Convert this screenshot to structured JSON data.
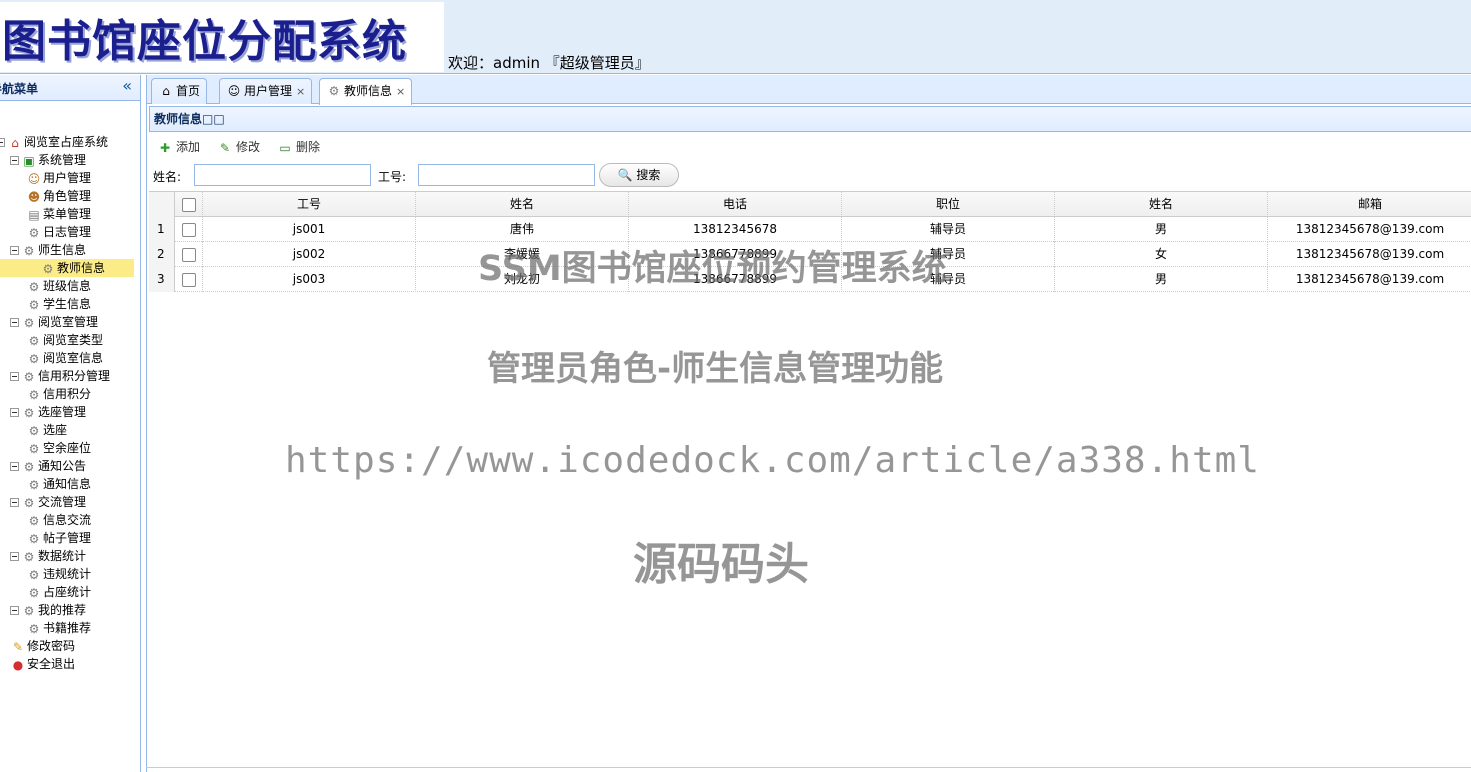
{
  "header": {
    "logo_text": "图书馆座位分配系统",
    "welcome": "欢迎：admin 『超级管理员』"
  },
  "sidebar": {
    "title": "导航菜单",
    "collapse_icon": "double-chevron-left-icon",
    "tree": [
      {
        "label": "阅览室占座系统",
        "icon": "home-icon"
      },
      {
        "label": "系统管理",
        "icon": "folder-icon"
      },
      {
        "label": "用户管理",
        "icon": "user-icon"
      },
      {
        "label": "角色管理",
        "icon": "users-icon"
      },
      {
        "label": "菜单管理",
        "icon": "menu-icon"
      },
      {
        "label": "日志管理",
        "icon": "gear-icon"
      },
      {
        "label": "师生信息",
        "icon": "gear-icon"
      },
      {
        "label": "教师信息",
        "icon": "gear-icon"
      },
      {
        "label": "班级信息",
        "icon": "gear-icon"
      },
      {
        "label": "学生信息",
        "icon": "gear-icon"
      },
      {
        "label": "阅览室管理",
        "icon": "gear-icon"
      },
      {
        "label": "阅览室类型",
        "icon": "gear-icon"
      },
      {
        "label": "阅览室信息",
        "icon": "gear-icon"
      },
      {
        "label": "信用积分管理",
        "icon": "gear-icon"
      },
      {
        "label": "信用积分",
        "icon": "gear-icon"
      },
      {
        "label": "选座管理",
        "icon": "gear-icon"
      },
      {
        "label": "选座",
        "icon": "gear-icon"
      },
      {
        "label": "空余座位",
        "icon": "gear-icon"
      },
      {
        "label": "通知公告",
        "icon": "gear-icon"
      },
      {
        "label": "通知信息",
        "icon": "gear-icon"
      },
      {
        "label": "交流管理",
        "icon": "gear-icon"
      },
      {
        "label": "信息交流",
        "icon": "gear-icon"
      },
      {
        "label": "帖子管理",
        "icon": "gear-icon"
      },
      {
        "label": "数据统计",
        "icon": "gear-icon"
      },
      {
        "label": "违规统计",
        "icon": "gear-icon"
      },
      {
        "label": "占座统计",
        "icon": "gear-icon"
      },
      {
        "label": "我的推荐",
        "icon": "gear-icon"
      },
      {
        "label": "书籍推荐",
        "icon": "gear-icon"
      },
      {
        "label": "修改密码",
        "icon": "lock-icon"
      },
      {
        "label": "安全退出",
        "icon": "exit-icon"
      }
    ],
    "selected": "教师信息"
  },
  "tabs": [
    {
      "label": "首页",
      "icon": "home-icon",
      "closable": false
    },
    {
      "label": "用户管理",
      "icon": "user-icon",
      "closable": true
    },
    {
      "label": "教师信息",
      "icon": "gear-icon",
      "closable": true,
      "active": true
    }
  ],
  "panel": {
    "title": "教师信息□□"
  },
  "toolbar": {
    "add_label": "添加",
    "edit_label": "修改",
    "delete_label": "删除"
  },
  "search": {
    "name_label": "姓名:",
    "name_value": "",
    "id_label": "工号:",
    "id_value": "",
    "button_label": "搜索"
  },
  "table": {
    "columns": [
      "工号",
      "姓名",
      "电话",
      "职位",
      "姓名",
      "邮箱"
    ],
    "rows": [
      {
        "num": "1",
        "cells": [
          "js001",
          "唐伟",
          "13812345678",
          "辅导员",
          "男",
          "13812345678@139.com"
        ]
      },
      {
        "num": "2",
        "cells": [
          "js002",
          "李媛媛",
          "13866778899",
          "辅导员",
          "女",
          "13812345678@139.com"
        ]
      },
      {
        "num": "3",
        "cells": [
          "js003",
          "刘龙初",
          "13866778899",
          "辅导员",
          "男",
          "13812345678@139.com"
        ]
      }
    ]
  },
  "watermark": {
    "line1": "SSM图书馆座位预约管理系统",
    "line2": "管理员角色-师生信息管理功能",
    "line3": "https://www.icodedock.com/article/a338.html",
    "line4": "源码码头"
  },
  "colors": {
    "header_bg": "#e2edfa",
    "border": "#95b8e7",
    "selected_bg": "#fbec88",
    "logo_text": "#1b1f8e"
  }
}
